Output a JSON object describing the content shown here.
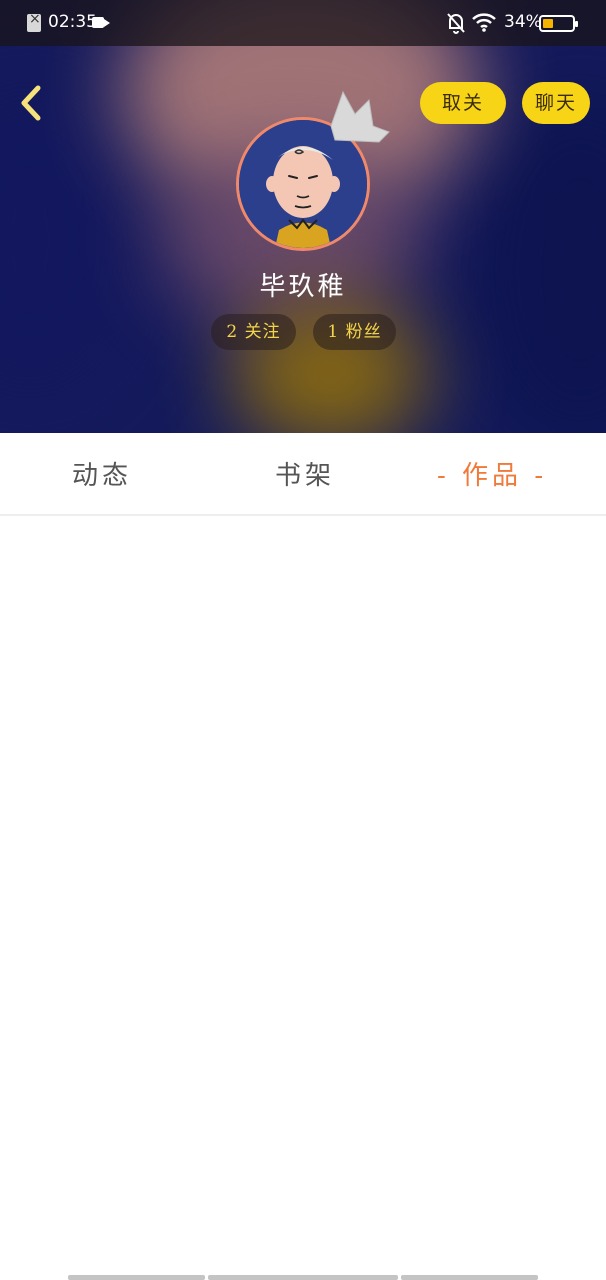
{
  "status_bar": {
    "time": "02:35",
    "battery_percent": "34%",
    "battery_level": 0.34
  },
  "header": {
    "unfollow_label": "取关",
    "chat_label": "聊天"
  },
  "profile": {
    "username": "毕玖稚",
    "following_count": "2",
    "following_label": "关注",
    "fans_count": "1",
    "fans_label": "粉丝",
    "following_text": "2 关注",
    "fans_text": "1 粉丝"
  },
  "tabs": {
    "dynamic": "动态",
    "shelf": "书架",
    "works": "作品",
    "works_display": "- 作品 -",
    "active": "works"
  },
  "colors": {
    "accent": "#f07a3a",
    "button_yellow": "#f7d416",
    "stat_text": "#f3d44a"
  }
}
